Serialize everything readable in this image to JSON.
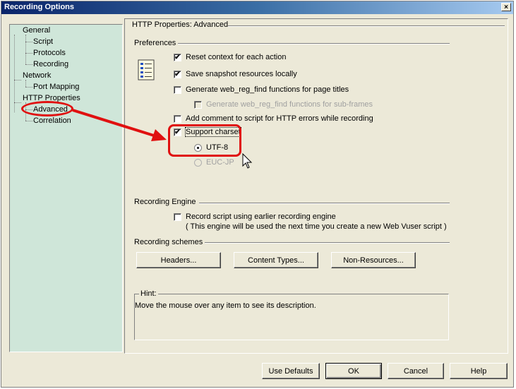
{
  "window": {
    "title": "Recording Options",
    "close_glyph": "×"
  },
  "tree": {
    "items": [
      {
        "label": "General"
      },
      {
        "label": "Script"
      },
      {
        "label": "Protocols"
      },
      {
        "label": "Recording"
      },
      {
        "label": "Network"
      },
      {
        "label": "Port Mapping"
      },
      {
        "label": "HTTP Properties"
      },
      {
        "label": "Advanced"
      },
      {
        "label": "Correlation"
      }
    ]
  },
  "panel": {
    "title": "HTTP Properties: Advanced",
    "preferences": {
      "heading": "Preferences",
      "icon": "document-list-icon",
      "options": [
        {
          "label": "Reset context for each action",
          "checked": "✔"
        },
        {
          "label": "Save snapshot resources locally",
          "checked": "✔"
        },
        {
          "label": "Generate web_reg_find functions for page titles",
          "checked": ""
        },
        {
          "label": "Generate web_reg_find functions for sub-frames",
          "checked": ""
        },
        {
          "label": "Add comment to script for HTTP errors while recording",
          "checked": ""
        },
        {
          "label": "Support charset",
          "checked": "✔"
        }
      ],
      "charsets": [
        {
          "label": "UTF-8",
          "selected": true
        },
        {
          "label": "EUC-JP",
          "selected": false
        }
      ]
    },
    "engine": {
      "heading": "Recording Engine",
      "option_label": "Record script using earlier recording engine",
      "option_note": "( This engine will be used the next time you create a new Web Vuser script )"
    },
    "schemes": {
      "heading": "Recording schemes",
      "headers_button": "Headers...",
      "content_types_button": "Content Types...",
      "non_resources_button": "Non-Resources..."
    },
    "hint": {
      "caption": "Hint:",
      "text": "Move the mouse over any item to see its description."
    }
  },
  "footer": {
    "use_defaults": "Use Defaults",
    "ok": "OK",
    "cancel": "Cancel",
    "help": "Help"
  },
  "annotation_color": "#e01010"
}
